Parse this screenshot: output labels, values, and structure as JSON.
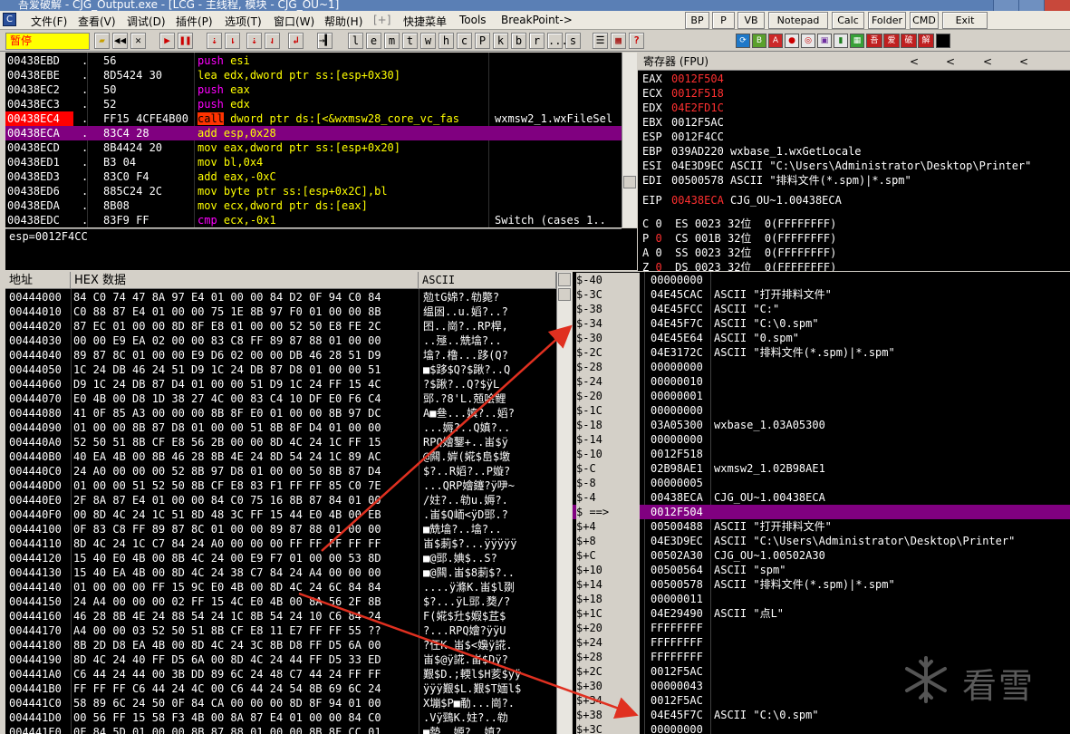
{
  "window": {
    "title": "吾爱破解 - CJG_Output.exe - [LCG - 主线程, 模块 - CJG_OU~1]"
  },
  "menubar": {
    "items": [
      "文件(F)",
      "查看(V)",
      "调试(D)",
      "插件(P)",
      "选项(T)",
      "窗口(W)",
      "帮助(H)",
      "[+]",
      "快捷菜单",
      "Tools",
      "BreakPoint->"
    ],
    "plugin_buttons": [
      "BP",
      "P",
      "VB",
      "Notepad",
      "Calc",
      "Folder",
      "CMD",
      "Exit"
    ]
  },
  "toolbar": {
    "status": "暂停",
    "buttons": [
      "open-icon",
      "rewind-icon",
      "close-icon",
      "run-icon",
      "pause-icon",
      "step-into-icon",
      "step-over-icon",
      "trace-into-icon",
      "trace-over-icon",
      "execute-till-return-icon",
      "goto-icon"
    ],
    "letters": [
      "l",
      "e",
      "m",
      "t",
      "w",
      "h",
      "c",
      "P",
      "k",
      "b",
      "r",
      "...",
      "s"
    ],
    "tail": [
      "list-icon",
      "grid-icon",
      "help-icon"
    ],
    "color_icons": [
      "refresh-icon",
      "plugin-b-icon",
      "plugin-a-icon",
      "record-icon",
      "target-icon",
      "image-icon",
      "bar-icon",
      "grid-green-icon",
      "吾",
      "爱",
      "破",
      "解",
      "black-square-icon"
    ]
  },
  "disasm": {
    "rows": [
      {
        "addr": "00438EBD",
        "dot": ".",
        "hex": "56",
        "op": "push",
        "args": "esi",
        "comment": "",
        "style": "push"
      },
      {
        "addr": "00438EBE",
        "dot": ".",
        "hex": "8D5424 30",
        "op": "lea",
        "args": "edx,dword ptr ss:[esp+0x30]",
        "comment": "",
        "style": "lea"
      },
      {
        "addr": "00438EC2",
        "dot": ".",
        "hex": "50",
        "op": "push",
        "args": "eax",
        "comment": "",
        "style": "push"
      },
      {
        "addr": "00438EC3",
        "dot": ".",
        "hex": "52",
        "op": "push",
        "args": "edx",
        "comment": "",
        "style": "push"
      },
      {
        "addr": "00438EC4",
        "dot": ".",
        "hex": "FF15 4CFE4B00",
        "op": "call",
        "args": "dword ptr ds:[<&wxmsw28_core_vc_fas",
        "comment": "wxmsw2_1.wxFileSel",
        "style": "call",
        "bp": true
      },
      {
        "addr": "00438ECA",
        "dot": ".",
        "hex": "83C4 28",
        "op": "add",
        "args": "esp,0x28",
        "comment": "",
        "style": "add",
        "selected": true
      },
      {
        "addr": "00438ECD",
        "dot": ".",
        "hex": "8B4424 20",
        "op": "mov",
        "args": "eax,dword ptr ss:[esp+0x20]",
        "comment": "",
        "style": "mov"
      },
      {
        "addr": "00438ED1",
        "dot": ".",
        "hex": "B3 04",
        "op": "mov",
        "args": "bl,0x4",
        "comment": "",
        "style": "mov"
      },
      {
        "addr": "00438ED3",
        "dot": ".",
        "hex": "83C0 F4",
        "op": "add",
        "args": "eax,-0xC",
        "comment": "",
        "style": "add"
      },
      {
        "addr": "00438ED6",
        "dot": ".",
        "hex": "885C24 2C",
        "op": "mov",
        "args": "byte ptr ss:[esp+0x2C],bl",
        "comment": "",
        "style": "mov"
      },
      {
        "addr": "00438EDA",
        "dot": ".",
        "hex": "8B08",
        "op": "mov",
        "args": "ecx,dword ptr ds:[eax]",
        "comment": "",
        "style": "mov"
      },
      {
        "addr": "00438EDC",
        "dot": ".",
        "hex": "83F9 FF",
        "op": "cmp",
        "args": "ecx,-0x1",
        "comment": "Switch (cases 1..",
        "style": "cmp"
      }
    ],
    "info": "esp=0012F4CC"
  },
  "registers": {
    "header": "寄存器 (FPU)",
    "header_arrows": [
      "<",
      "<",
      "<",
      "<"
    ],
    "rows": [
      {
        "name": "EAX",
        "value": "0012F504",
        "comment": "",
        "changed": true
      },
      {
        "name": "ECX",
        "value": "0012F518",
        "comment": "",
        "changed": true
      },
      {
        "name": "EDX",
        "value": "04E2FD1C",
        "comment": "",
        "changed": true
      },
      {
        "name": "EBX",
        "value": "0012F5AC",
        "comment": "",
        "changed": false
      },
      {
        "name": "ESP",
        "value": "0012F4CC",
        "comment": "",
        "changed": false
      },
      {
        "name": "EBP",
        "value": "039AD220",
        "comment": "wxbase_1.wxGetLocale",
        "changed": false
      },
      {
        "name": "ESI",
        "value": "04E3D9EC",
        "comment": "ASCII \"C:\\Users\\Administrator\\Desktop\\Printer\"",
        "changed": false
      },
      {
        "name": "EDI",
        "value": "00500578",
        "comment": "ASCII \"排料文件(*.spm)|*.spm\"",
        "changed": false
      },
      {
        "name": "EIP",
        "value": "00438ECA",
        "comment": "CJG_OU~1.00438ECA",
        "changed": true
      }
    ],
    "flags": [
      {
        "f": "C",
        "v": "0",
        "seg": "ES",
        "sel": "0023",
        "bits": "32位",
        "range": "0(FFFFFFFF)",
        "red": false
      },
      {
        "f": "P",
        "v": "0",
        "seg": "CS",
        "sel": "001B",
        "bits": "32位",
        "range": "0(FFFFFFFF)",
        "red": true
      },
      {
        "f": "A",
        "v": "0",
        "seg": "SS",
        "sel": "0023",
        "bits": "32位",
        "range": "0(FFFFFFFF)",
        "red": false
      },
      {
        "f": "Z",
        "v": "0",
        "seg": "DS",
        "sel": "0023",
        "bits": "32位",
        "range": "0(FFFFFFFF)",
        "red": true
      }
    ]
  },
  "dump": {
    "headers": {
      "addr": "地址",
      "hex": "HEX 数据",
      "ascii": "ASCII"
    },
    "rows": [
      {
        "a": "00444000",
        "h": "84 C0 74 47 8A 97 E4 01 00 00 84 D2 0F 94 C0 84",
        "s": "勊tG婂?.劺斃?"
      },
      {
        "a": "00444010",
        "h": "C0 88 87 E4 01 00 00 75 1E 8B 97 F0 01 00 00 8B",
        "s": "缊囦..u.嫍?..?"
      },
      {
        "a": "00444020",
        "h": "87 EC 01 00 00 8D 8F E8 01 00 00 52 50 E8 FE 2C",
        "s": "囨..崗?..RP桿,"
      },
      {
        "a": "00444030",
        "h": "00 00 E9 EA 02 00 00 83 C8 FF 89 87 88 01 00 00",
        "s": "..殛..兟墖?.."
      },
      {
        "a": "00444040",
        "h": "89 87 8C 01 00 00 E9 D6 02 00 00 DB 46 28 51 D9",
        "s": "墖?.橹...跢(Q?"
      },
      {
        "a": "00444050",
        "h": "1C 24 DB 46 24 51 D9 1C 24 DB 87 D8 01 00 00 51",
        "s": "■$跢$Q?$踿?..Q"
      },
      {
        "a": "00444060",
        "h": "D9 1C 24 DB 87 D4 01 00 00 51 D9 1C 24 FF 15 4C",
        "s": "?$踿?..Q?$ÿL"
      },
      {
        "a": "00444070",
        "h": "E0 4B 00 D8 1D 38 27 4C 00 83 C4 10 DF E0 F6 C4",
        "s": "郖.?8'L.兡哙鲤"
      },
      {
        "a": "00444080",
        "h": "41 0F 85 A3 00 00 00 8B 8F E0 01 00 00 8B 97 DC",
        "s": "A■叄...嫃?..嫍?"
      },
      {
        "a": "00444090",
        "h": "01 00 00 8B 87 D8 01 00 00 51 8B 8F D4 01 00 00",
        "s": "...媷?..Q嫃?.."
      },
      {
        "a": "004440A0",
        "h": "52 50 51 8B CF E8 56 2B 00 00 8D 4C 24 1C FF 15",
        "s": "RPQ嬒鑋+..峀$ÿ"
      },
      {
        "a": "004440B0",
        "h": "40 EA 4B 00 8B 46 28 8B 4E 24 8D 54 24 1C 89 AC",
        "s": "@闗.婩(婲$峊$墽"
      },
      {
        "a": "004440C0",
        "h": "24 A0 00 00 00 52 8B 97 D8 01 00 00 50 8B 87 D4",
        "s": "$?..R嫍?..P嫙?"
      },
      {
        "a": "004440D0",
        "h": "01 00 00 51 52 50 8B CF E8 83 F1 FF FF 85 C0 7E",
        "s": "...QRP嬒鑳?ÿ吚~"
      },
      {
        "a": "004440E0",
        "h": "2F 8A 87 E4 01 00 00 84 C0 75 16 8B 87 84 01 00",
        "s": "/妵?..劺u.媷?."
      },
      {
        "a": "004440F0",
        "h": "00 8D 4C 24 1C 51 8D 48 3C FF 15 44 E0 4B 00 EB",
        "s": ".峀$Q峏<ÿD郖.?"
      },
      {
        "a": "00444100",
        "h": "0F 83 C8 FF 89 87 8C 01 00 00 89 87 88 01 00 00",
        "s": "■兟墖?..墖?.."
      },
      {
        "a": "00444110",
        "h": "8D 4C 24 1C C7 84 24 A0 00 00 00 FF FF FF FF FF",
        "s": "峀$莿$?...ÿÿÿÿÿ"
      },
      {
        "a": "00444120",
        "h": "15 40 E0 4B 00 8B 4C 24 00 E9 F7 01 00 00 53 8D",
        "s": "■@郖.婰$..S?"
      },
      {
        "a": "00444130",
        "h": "15 40 EA 4B 00 8D 4C 24 38 C7 84 24 A4 00 00 00",
        "s": "■@闗.峀$8莿$?.."
      },
      {
        "a": "00444140",
        "h": "01 00 00 00 FF 15 9C E0 4B 00 8D 4C 24 6C 84 84",
        "s": "....ÿ滌K.峀$l剟"
      },
      {
        "a": "00444150",
        "h": "24 A4 00 00 00 02 FF 15 4C E0 4B 00 8A 56 2F 8B",
        "s": "$?...ÿL郖.奦/?"
      },
      {
        "a": "00444160",
        "h": "46 28 8B 4E 24 88 54 24 1C 8B 54 24 10 C6 84 24",
        "s": "F(婲$圱$婽$茊$"
      },
      {
        "a": "00444170",
        "h": "A4 00 00 03 52 50 51 8B CF E8 11 E7 FF FF 55 ??",
        "s": "?...RPQ嬒?ÿÿU"
      },
      {
        "a": "00444180",
        "h": "8B 2D D8 EA 4B 00 8D 4C 24 3C 8B D8 FF D5 6A 00",
        "s": "?仼K.峀$<嬝ÿ誮."
      },
      {
        "a": "00444190",
        "h": "8D 4C 24 40 FF D5 6A 00 8D 4C 24 44 FF D5 33 ED",
        "s": "峀$@ÿ誮.峀$Dÿ?"
      },
      {
        "a": "004441A0",
        "h": "C6 44 24 44 00 3B DD 89 6C 24 48 C7 44 24 FF FF",
        "s": "艱$D.;輭l$H荄$ÿÿ"
      },
      {
        "a": "004441B0",
        "h": "FF FF FF C6 44 24 4C 00 C6 44 24 54 8B 69 6C 24",
        "s": "ÿÿÿ艱$L.艱$T媔l$"
      },
      {
        "a": "004441C0",
        "h": "58 89 6C 24 50 0F 84 CA 00 00 00 8D 8F 94 01 00",
        "s": "X塴$P■勈...崗?."
      },
      {
        "a": "004441D0",
        "h": "00 56 FF 15 58 F3 4B 00 8A 87 E4 01 00 00 84 C0",
        "s": ".Vÿ鵛K.妵?..劺"
      },
      {
        "a": "004441E0",
        "h": "0F 84 5D 01 00 00 8B 87 88 01 00 00 8B 8F CC 01",
        "s": "■勢..嫄?..嫃?"
      }
    ]
  },
  "stack": {
    "rows": [
      {
        "o": "$-40",
        "v": "00000000",
        "c": ""
      },
      {
        "o": "$-3C",
        "v": "04E45CAC",
        "c": "ASCII \"打开排料文件\""
      },
      {
        "o": "$-38",
        "v": "04E45FCC",
        "c": "ASCII \"C:\""
      },
      {
        "o": "$-34",
        "v": "04E45F7C",
        "c": "ASCII \"C:\\0.spm\""
      },
      {
        "o": "$-30",
        "v": "04E45E64",
        "c": "ASCII \"0.spm\""
      },
      {
        "o": "$-2C",
        "v": "04E3172C",
        "c": "ASCII \"排料文件(*.spm)|*.spm\""
      },
      {
        "o": "$-28",
        "v": "00000000",
        "c": ""
      },
      {
        "o": "$-24",
        "v": "00000010",
        "c": ""
      },
      {
        "o": "$-20",
        "v": "00000001",
        "c": ""
      },
      {
        "o": "$-1C",
        "v": "00000000",
        "c": ""
      },
      {
        "o": "$-18",
        "v": "03A05300",
        "c": "wxbase_1.03A05300"
      },
      {
        "o": "$-14",
        "v": "00000000",
        "c": ""
      },
      {
        "o": "$-10",
        "v": "0012F518",
        "c": ""
      },
      {
        "o": "$-C",
        "v": "02B98AE1",
        "c": "wxmsw2_1.02B98AE1"
      },
      {
        "o": "$-8",
        "v": "00000005",
        "c": ""
      },
      {
        "o": "$-4",
        "v": "00438ECA",
        "c": "CJG_OU~1.00438ECA"
      },
      {
        "o": "$ ==>",
        "v": "0012F504",
        "c": "",
        "sel": true
      },
      {
        "o": "$+4",
        "v": "00500488",
        "c": "ASCII \"打开排料文件\""
      },
      {
        "o": "$+8",
        "v": "04E3D9EC",
        "c": "ASCII \"C:\\Users\\Administrator\\Desktop\\Printer\""
      },
      {
        "o": "$+C",
        "v": "00502A30",
        "c": "CJG_OU~1.00502A30"
      },
      {
        "o": "$+10",
        "v": "00500564",
        "c": "ASCII \"spm\""
      },
      {
        "o": "$+14",
        "v": "00500578",
        "c": "ASCII \"排料文件(*.spm)|*.spm\""
      },
      {
        "o": "$+18",
        "v": "00000011",
        "c": ""
      },
      {
        "o": "$+1C",
        "v": "04E29490",
        "c": "ASCII \"点L\""
      },
      {
        "o": "$+20",
        "v": "FFFFFFFF",
        "c": ""
      },
      {
        "o": "$+24",
        "v": "FFFFFFFF",
        "c": ""
      },
      {
        "o": "$+28",
        "v": "FFFFFFFF",
        "c": ""
      },
      {
        "o": "$+2C",
        "v": "0012F5AC",
        "c": ""
      },
      {
        "o": "$+30",
        "v": "00000043",
        "c": ""
      },
      {
        "o": "$+34",
        "v": "0012F5AC",
        "c": ""
      },
      {
        "o": "$+38",
        "v": "04E45F7C",
        "c": "ASCII \"C:\\0.spm\""
      },
      {
        "o": "$+3C",
        "v": "00000000",
        "c": ""
      }
    ]
  },
  "watermark": {
    "text": "看雪"
  },
  "colors": {
    "accent_red": "#ff0000",
    "selection": "#800080",
    "annotation_arrow": "#e03020"
  }
}
